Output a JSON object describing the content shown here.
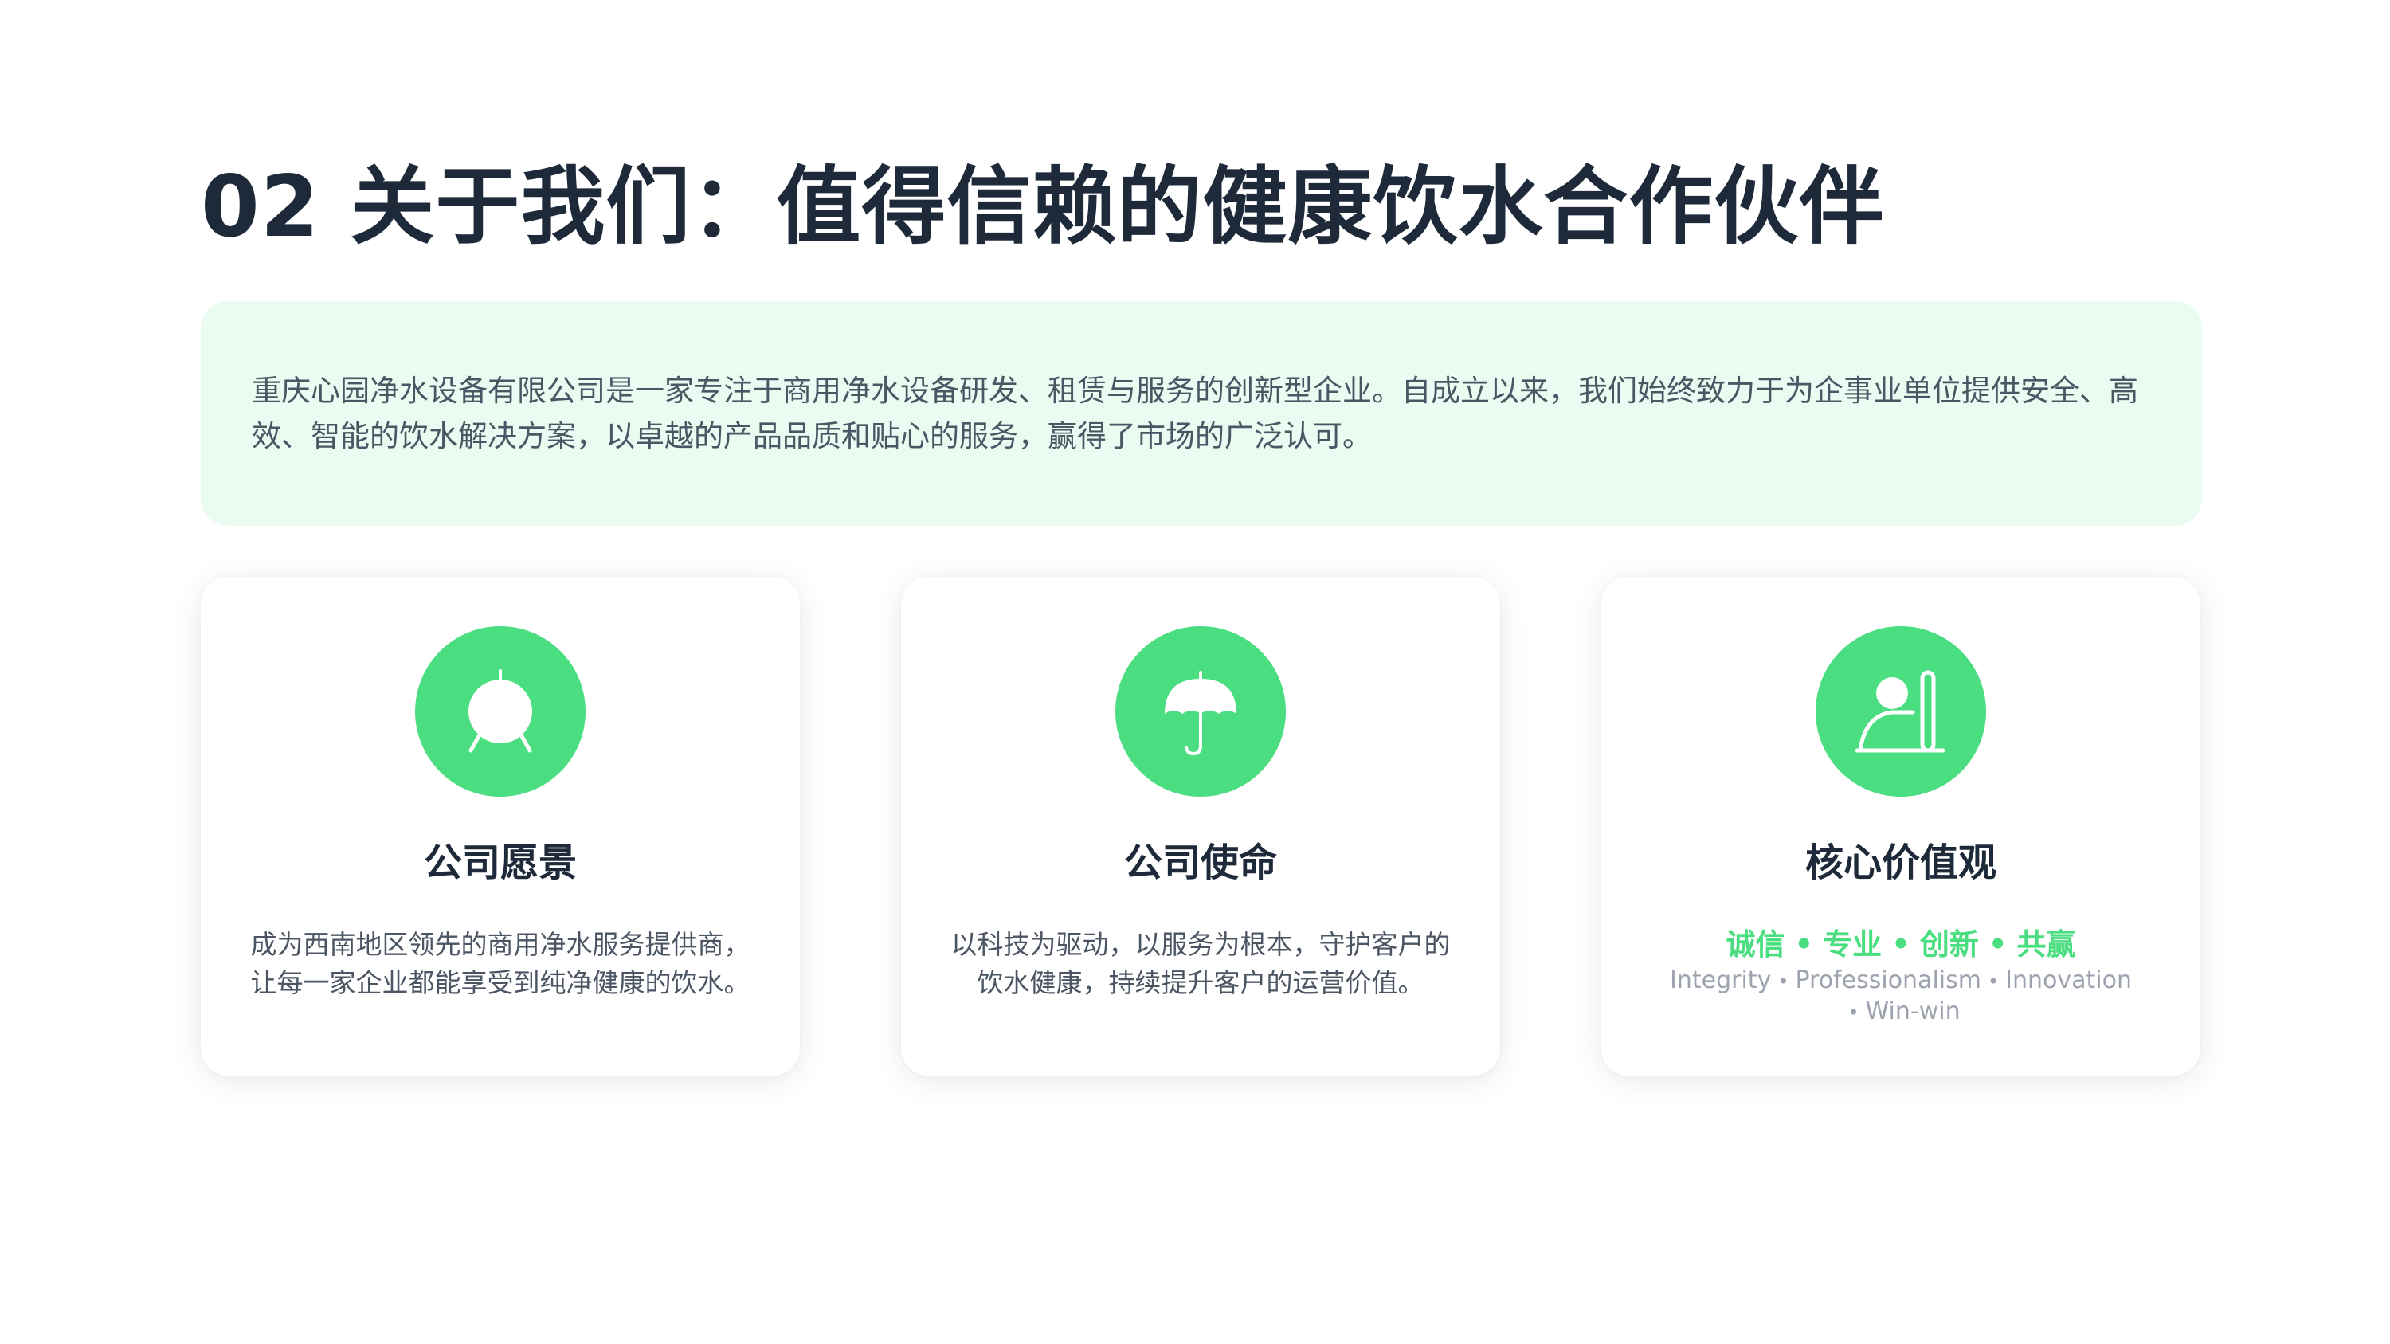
{
  "slide": {
    "title": "02 关于我们：值得信赖的健康饮水合作伙伴"
  },
  "intro": {
    "text": "重庆心园净水设备有限公司是一家专注于商用净水设备研发、租赁与服务的创新型企业。自成立以来，我们始终致力于为企事业单位提供安全、高效、智能的饮水解决方案，以卓越的产品品质和贴心的服务，赢得了市场的广泛认可。"
  },
  "cards": [
    {
      "icon": "vision-target-icon",
      "title": "公司愿景",
      "description": "成为西南地区领先的商用净水服务提供商，让每一家企业都能享受到纯净健康的饮水。"
    },
    {
      "icon": "umbrella-icon",
      "title": "公司使命",
      "description": "以科技为驱动，以服务为根本，守护客户的饮水健康，持续提升客户的运营价值。"
    },
    {
      "icon": "person-values-icon",
      "title": "核心价值观",
      "values_cn": [
        "诚信",
        "专业",
        "创新",
        "共赢"
      ],
      "values_en": [
        "Integrity",
        "Professionalism",
        "Innovation",
        "Win-win"
      ],
      "separator": "•"
    }
  ],
  "colors": {
    "accent": "#4ade80",
    "intro_background": "#eafbf1",
    "title_text": "#1e2a3a",
    "body_text": "#4b5563",
    "muted_text": "#9ca3af"
  }
}
